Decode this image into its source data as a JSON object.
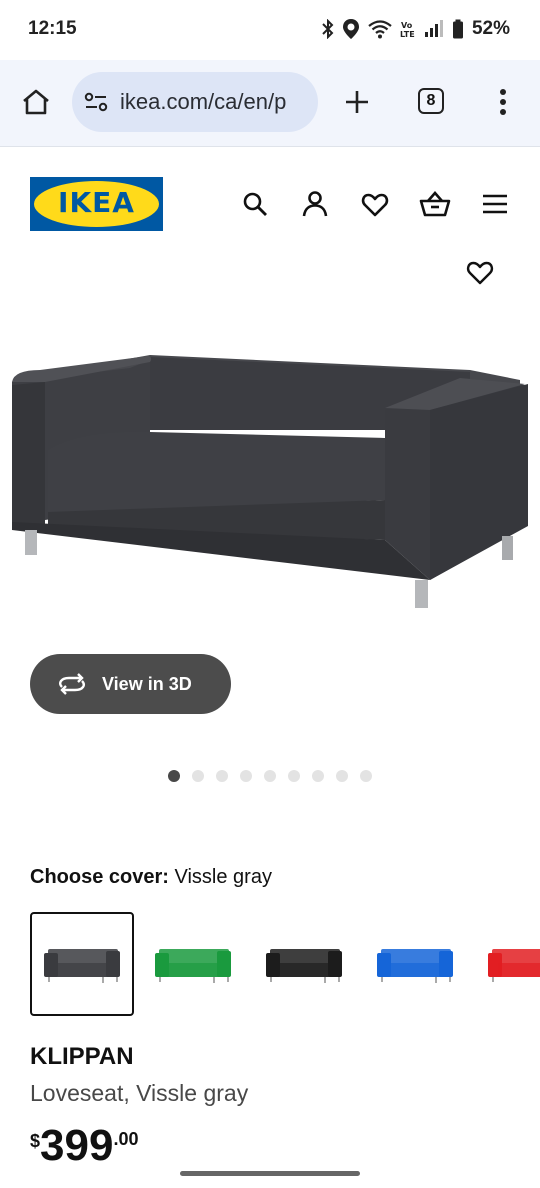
{
  "status_bar": {
    "time": "12:15",
    "battery_percent": "52%",
    "icons": [
      "bluetooth-icon",
      "location-icon",
      "wifi-icon",
      "volte-icon",
      "signal-icon",
      "battery-icon"
    ]
  },
  "browser": {
    "url": "ikea.com/ca/en/p",
    "tab_count": "8",
    "icons": [
      "home-icon",
      "site-settings-icon",
      "new-tab-icon",
      "tabs-icon",
      "more-menu-icon"
    ]
  },
  "header": {
    "logo_text": "IKEA",
    "icons": [
      "search-icon",
      "account-icon",
      "favorites-icon",
      "cart-icon",
      "menu-icon"
    ]
  },
  "product": {
    "view_3d_label": "View in 3D",
    "carousel": {
      "total": 9,
      "active_index": 0
    },
    "cover_label": "Choose cover:",
    "cover_value": "Vissle gray",
    "swatches": [
      {
        "name": "Vissle gray",
        "color": "#3a3b3f",
        "selected": true
      },
      {
        "name": "green",
        "color": "#1a9a3e",
        "selected": false
      },
      {
        "name": "black",
        "color": "#1c1c1c",
        "selected": false
      },
      {
        "name": "blue",
        "color": "#1565d8",
        "selected": false
      },
      {
        "name": "red",
        "color": "#e21e22",
        "selected": false
      }
    ],
    "name": "KLIPPAN",
    "description": "Loveseat, Vissle gray",
    "price": {
      "currency": "$",
      "integer": "399",
      "decimal": ".00"
    }
  }
}
